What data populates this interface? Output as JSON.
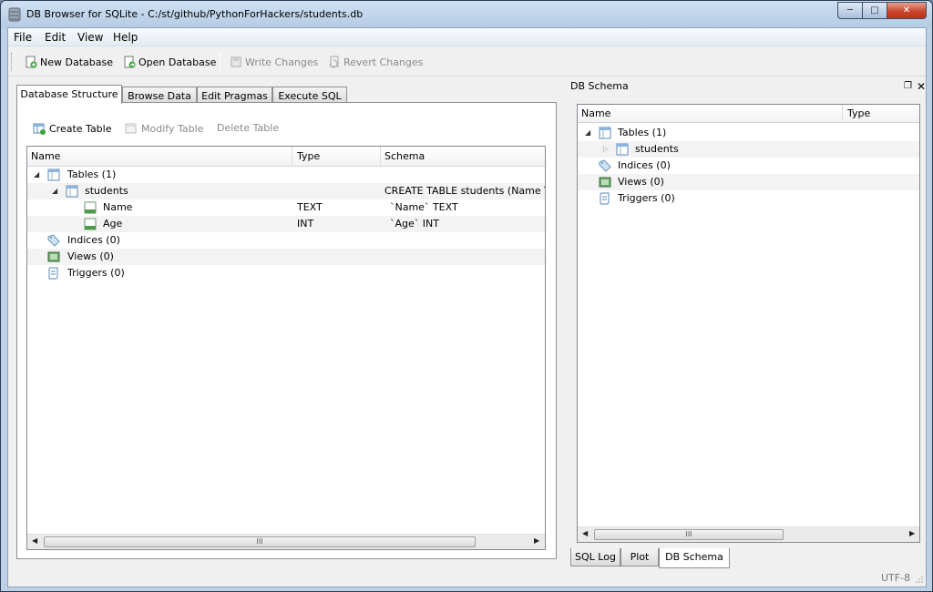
{
  "window": {
    "title": "DB Browser for SQLite - C:/st/github/PythonForHackers/students.db",
    "minimize_icon": "minimize-icon",
    "maximize_icon": "maximize-icon",
    "close_icon": "close-icon"
  },
  "menu": [
    "File",
    "Edit",
    "View",
    "Help"
  ],
  "toolbar": {
    "new_database": "New Database",
    "open_database": "Open Database",
    "write_changes": "Write Changes",
    "revert_changes": "Revert Changes"
  },
  "tabs": [
    "Database Structure",
    "Browse Data",
    "Edit Pragmas",
    "Execute SQL"
  ],
  "structure": {
    "create_table": "Create Table",
    "modify_table": "Modify Table",
    "delete_table": "Delete Table",
    "columns": [
      "Name",
      "Type",
      "Schema"
    ],
    "rows": {
      "tables": "Tables (1)",
      "students": "students",
      "students_schema": "CREATE TABLE students (Name TE",
      "name_field": "Name",
      "name_type": "TEXT",
      "name_schema": "`Name` TEXT",
      "age_field": "Age",
      "age_type": "INT",
      "age_schema": "`Age` INT",
      "indices": "Indices (0)",
      "views": "Views (0)",
      "triggers": "Triggers (0)"
    },
    "scroll_thumb": "III"
  },
  "schema_dock": {
    "title": "DB Schema",
    "float_icon": "float-icon",
    "close_icon": "close-icon",
    "columns": [
      "Name",
      "Type"
    ],
    "rows": {
      "tables": "Tables (1)",
      "students": "students",
      "indices": "Indices (0)",
      "views": "Views (0)",
      "triggers": "Triggers (0)"
    },
    "scroll_thumb": "III"
  },
  "bottom_tabs": [
    "SQL Log",
    "Plot",
    "DB Schema"
  ],
  "status": {
    "encoding": "UTF-8"
  },
  "colors": {
    "title_bar": "#bcd0e6",
    "close_button": "#c8472d",
    "selection_row": "#f3f3f3"
  }
}
